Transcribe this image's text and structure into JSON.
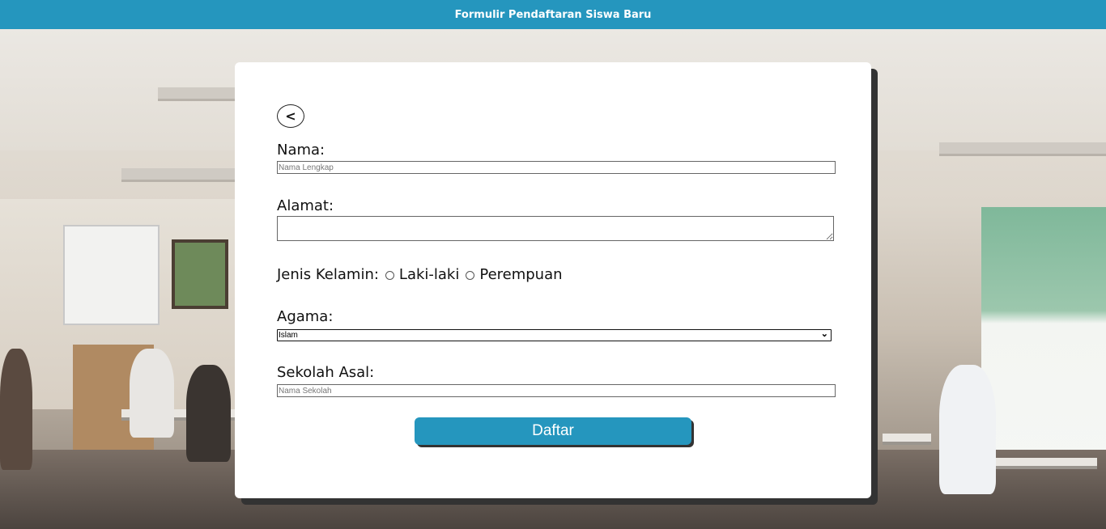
{
  "header": {
    "title": "Formulir Pendaftaran Siswa Baru"
  },
  "form": {
    "back_label": "<",
    "nama": {
      "label": "Nama:",
      "placeholder": "Nama Lengkap",
      "value": ""
    },
    "alamat": {
      "label": "Alamat:",
      "value": ""
    },
    "jenis_kelamin": {
      "label": "Jenis Kelamin:",
      "options": [
        "Laki-laki",
        "Perempuan"
      ]
    },
    "agama": {
      "label": "Agama:",
      "selected": "Islam"
    },
    "sekolah_asal": {
      "label": "Sekolah Asal:",
      "placeholder": "Nama Sekolah",
      "value": ""
    },
    "submit_label": "Daftar"
  },
  "colors": {
    "accent": "#2596be",
    "card": "#ffffff",
    "card_shadow": "#333333"
  },
  "icons": {
    "back": "chevron-left-icon",
    "select": "chevron-down-icon"
  }
}
